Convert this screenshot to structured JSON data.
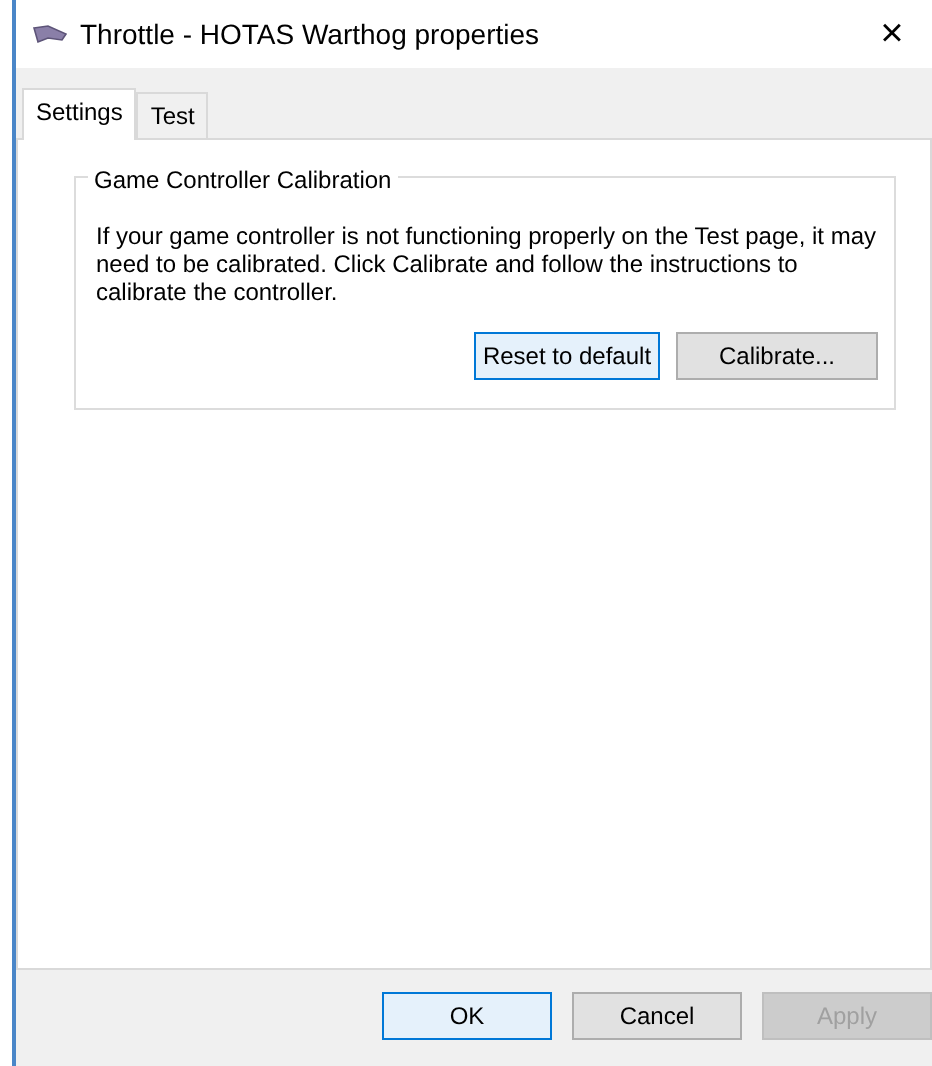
{
  "window": {
    "title": "Throttle - HOTAS Warthog properties",
    "close": "×"
  },
  "tabs": [
    {
      "label": "Settings",
      "selected": true
    },
    {
      "label": "Test",
      "selected": false
    }
  ],
  "group": {
    "title": "Game Controller Calibration",
    "text": "If your game controller is not functioning properly on the Test page, it may need to be calibrated.  Click Calibrate and follow the instructions to calibrate the controller.",
    "buttons": [
      {
        "label": "Reset to default",
        "focused": true,
        "disabled": false
      },
      {
        "label": "Calibrate...",
        "focused": false,
        "disabled": false
      }
    ]
  },
  "dialog_buttons": [
    {
      "label": "OK",
      "focused": true,
      "disabled": false
    },
    {
      "label": "Cancel",
      "focused": false,
      "disabled": false
    },
    {
      "label": "Apply",
      "focused": false,
      "disabled": true
    }
  ]
}
